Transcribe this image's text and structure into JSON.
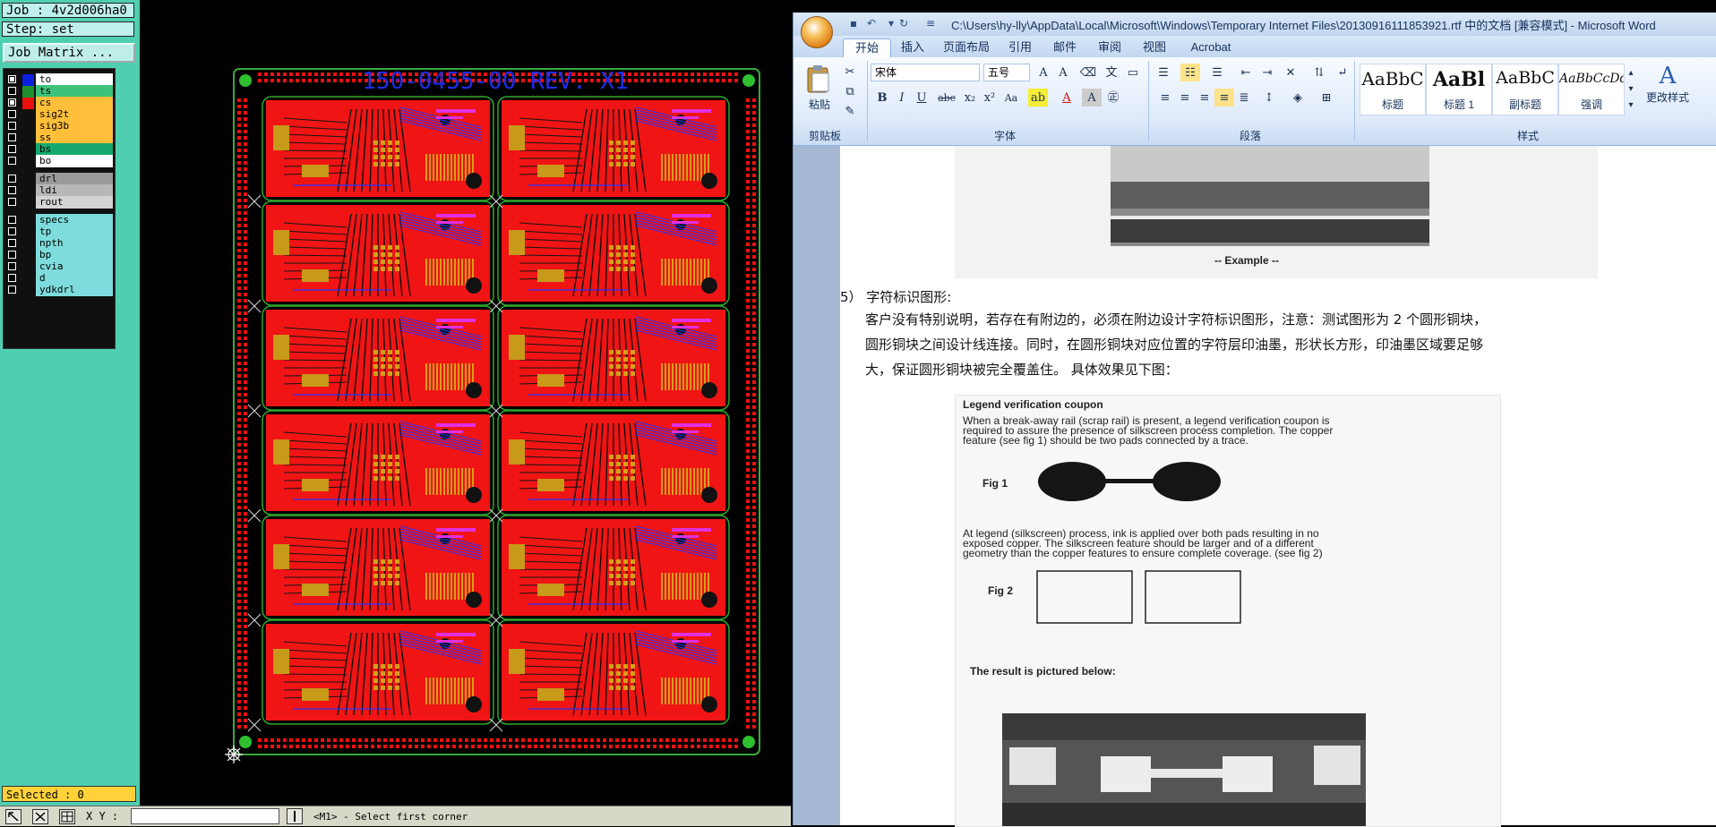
{
  "cam": {
    "job_label": "Job : 4v2d006ha0",
    "step_label": "Step: set",
    "job_matrix_button": "Job Matrix ...",
    "layers": [
      {
        "name": "to",
        "swatch": "#0b1fe0",
        "bg": "#ffffff",
        "checked": true
      },
      {
        "name": "ts",
        "swatch": "#1f8f2e",
        "bg": "#3ec27a",
        "checked": false
      },
      {
        "name": "cs",
        "swatch": "#ee1010",
        "bg": "#ffbf3a",
        "checked": true
      },
      {
        "name": "sig2t",
        "swatch": "",
        "bg": "#ffbf3a",
        "checked": false
      },
      {
        "name": "sig3b",
        "swatch": "",
        "bg": "#ffbf3a",
        "checked": false
      },
      {
        "name": "ss",
        "swatch": "",
        "bg": "#ffbf3a",
        "checked": false
      },
      {
        "name": "bs",
        "swatch": "",
        "bg": "#16a86c",
        "checked": false
      },
      {
        "name": "bo",
        "swatch": "",
        "bg": "#ffffff",
        "checked": false
      },
      {
        "name": "drl",
        "swatch": "",
        "bg": "#9a9a9a",
        "checked": false
      },
      {
        "name": "ldi",
        "swatch": "",
        "bg": "#b7b7b7",
        "checked": false
      },
      {
        "name": "rout",
        "swatch": "",
        "bg": "#d3d3d3",
        "checked": false
      },
      {
        "name": "specs",
        "swatch": "",
        "bg": "#7fdcdc",
        "checked": false
      },
      {
        "name": "tp",
        "swatch": "",
        "bg": "#7fdcdc",
        "checked": false
      },
      {
        "name": "npth",
        "swatch": "",
        "bg": "#7fdcdc",
        "checked": false
      },
      {
        "name": "bp",
        "swatch": "",
        "bg": "#7fdcdc",
        "checked": false
      },
      {
        "name": "cvia",
        "swatch": "",
        "bg": "#7fdcdc",
        "checked": false
      },
      {
        "name": "d",
        "swatch": "",
        "bg": "#7fdcdc",
        "checked": false
      },
      {
        "name": "ydkdrl",
        "swatch": "",
        "bg": "#7fdcdc",
        "checked": false
      }
    ],
    "selected_label": "Selected : 0",
    "xy_label": "X Y :",
    "status_message": "<M1> - Select first corner",
    "board_title": "150-0455-00 REV. X1"
  },
  "word": {
    "title": "C:\\Users\\hy-lly\\AppData\\Local\\Microsoft\\Windows\\Temporary Internet Files\\20130916111853921.rtf 中的文档 [兼容模式] - Microsoft Word",
    "tabs": [
      "开始",
      "插入",
      "页面布局",
      "引用",
      "邮件",
      "审阅",
      "视图",
      "Acrobat"
    ],
    "font_name": "宋体",
    "font_size": "五号",
    "paste_label": "粘贴",
    "group_labels": {
      "clipboard": "剪贴板",
      "font": "字体",
      "paragraph": "段落",
      "styles": "样式"
    },
    "styles": [
      {
        "preview": "AaBbC",
        "name": "标题"
      },
      {
        "preview": "AaBl",
        "name": "标题 1"
      },
      {
        "preview": "AaBbC",
        "name": "副标题"
      },
      {
        "preview": "AaBbCcDd",
        "name": "强调"
      }
    ],
    "change_styles_label": "更改样式",
    "doc": {
      "example_caption": "-- Example --",
      "heading": "5） 字符标识图形:",
      "para_line1": "客户没有特别说明，若存在有附边的，必须在附边设计字符标识图形，注意：测试图形为 2 个圆形铜块，",
      "para_line2": "圆形铜块之间设计线连接。同时，在圆形铜块对应位置的字符层印油墨，形状长方形，印油墨区域要足够",
      "para_line3": "大，保证圆形铜块被完全覆盖住。  具体效果见下图：",
      "scan_title": "Legend verification coupon",
      "scan_p1": [
        "When a break-away rail (scrap rail) is present, a legend verification coupon is",
        "required to assure the presence of silkscreen process completion.  The copper",
        "feature (see fig 1) should be two pads connected by a trace."
      ],
      "fig1": "Fig 1",
      "scan_p2": [
        "At legend (silkscreen) process, ink is applied over both pads resulting in no",
        "exposed copper.  The silkscreen feature should be larger and of a different",
        "geometry than the copper features to ensure complete coverage.  (see fig 2)"
      ],
      "fig2": "Fig 2",
      "result_text": "The result is pictured below:"
    }
  }
}
